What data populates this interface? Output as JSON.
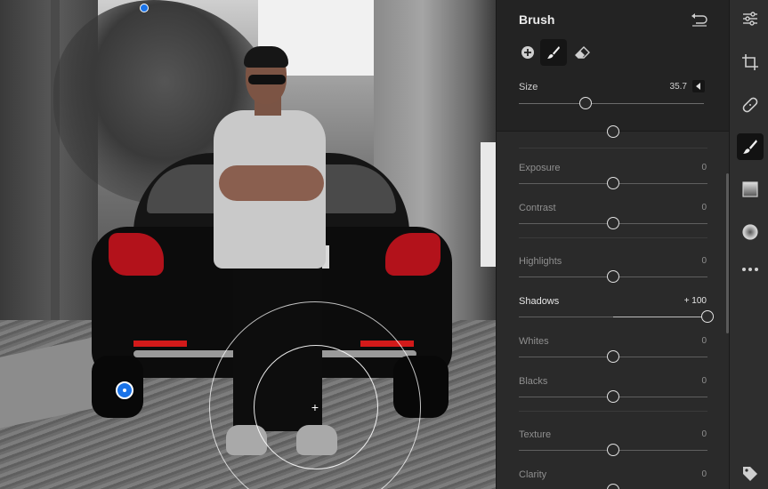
{
  "panel": {
    "title": "Brush",
    "size_label": "Size",
    "size_value": "35.7",
    "size_fraction": 0.36
  },
  "adjustments": [
    {
      "label": "Exposure",
      "value": "0",
      "fraction": 0.5
    },
    {
      "label": "Contrast",
      "value": "0",
      "fraction": 0.5
    },
    {
      "label": "Highlights",
      "value": "0",
      "fraction": 0.5
    },
    {
      "label": "Shadows",
      "value": "+ 100",
      "fraction": 1.0,
      "active": true
    },
    {
      "label": "Whites",
      "value": "0",
      "fraction": 0.5
    },
    {
      "label": "Blacks",
      "value": "0",
      "fraction": 0.5
    },
    {
      "label": "Texture",
      "value": "0",
      "fraction": 0.5
    },
    {
      "label": "Clarity",
      "value": "0",
      "fraction": 0.5
    }
  ],
  "colors": {
    "accent": "#1a73e8",
    "panel_bg": "#2a2a2a",
    "rail_bg": "#2e2e2e"
  },
  "rail_icons": [
    "edit-sliders-icon",
    "crop-icon",
    "healing-icon",
    "brush-icon",
    "linear-gradient-icon",
    "radial-gradient-icon",
    "more-icon",
    "tag-icon"
  ]
}
